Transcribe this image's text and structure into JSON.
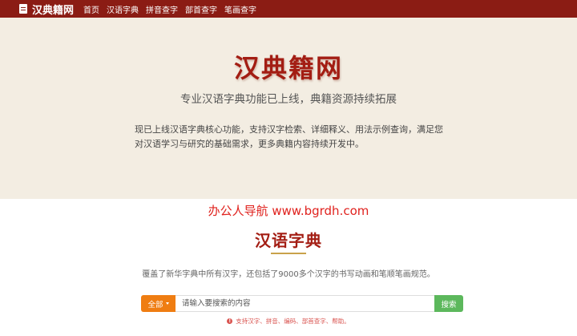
{
  "nav": {
    "brand": "汉典籍网",
    "links": [
      "首页",
      "汉语字典",
      "拼音查字",
      "部首查字",
      "笔画查字"
    ]
  },
  "hero": {
    "title": "汉典籍网",
    "subtitle": "专业汉语字典功能已上线，典籍资源持续拓展",
    "description": "现已上线汉语字典核心功能，支持汉字检索、详细释义、用法示例查询，满足您对汉语学习与研究的基础需求，更多典籍内容持续开发中。"
  },
  "promo": "办公人导航 www.bgrdh.com",
  "dictionary": {
    "title": "汉语字典",
    "description": "覆盖了新华字典中所有汉字，还包括了9000多个汉字的书写动画和笔顺笔画规范。",
    "search": {
      "scope_label": "全部",
      "placeholder": "请输入要搜索的内容",
      "button_label": "搜索",
      "hint": "支持汉字、拼音、编码、部首查字、帮助。"
    }
  },
  "colors": {
    "nav_bg": "#8b1c14",
    "hero_bg": "#f3ede2",
    "title_red": "#a31d13",
    "promo_red": "#e0221e",
    "scope_orange": "#ef7d12",
    "search_green": "#5cb85c",
    "underline_gold": "#c9a24a"
  }
}
